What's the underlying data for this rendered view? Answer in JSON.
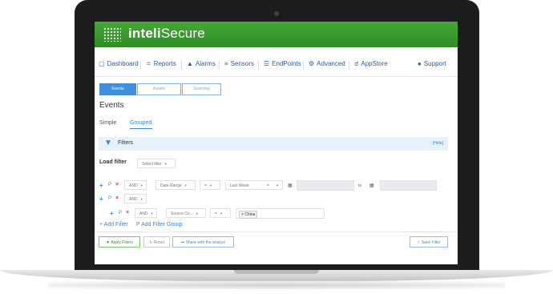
{
  "header": {
    "logo_prefix": "inteli",
    "logo_suffix": "Secure"
  },
  "nav": {
    "items": [
      {
        "label": "Dashboard",
        "icon": "monitor-icon"
      },
      {
        "label": "Reports",
        "icon": "chart-icon"
      },
      {
        "label": "Alarms",
        "icon": "bell-icon"
      },
      {
        "label": "Sensors",
        "icon": "sliders-icon"
      },
      {
        "label": "EndPoints",
        "icon": "list-icon"
      },
      {
        "label": "Advanced",
        "icon": "cogs-icon"
      },
      {
        "label": "AppStore",
        "icon": "cart-icon"
      }
    ],
    "support": {
      "label": "Support",
      "icon": "chat-icon"
    }
  },
  "tabs": [
    "Events",
    "Assets",
    "Scanning"
  ],
  "page_title": "Events",
  "subtabs": [
    "Simple",
    "Grouped"
  ],
  "filters": {
    "title": "Filters",
    "hide_label": "[Hide]"
  },
  "load_filter": {
    "label": "Load filter",
    "placeholder": "Select filter"
  },
  "rows": {
    "r1": {
      "op": "AND",
      "field": "Date Range",
      "cond": "=",
      "value": "Last Week",
      "value_op": "=",
      "to": "to"
    },
    "r2": {
      "op": "AND"
    },
    "r3": {
      "op": "AND",
      "field": "Source Co...",
      "cond": "=",
      "tag": "China",
      "tag_remove": "×"
    }
  },
  "row_controls": {
    "add": "+",
    "group": "P",
    "remove": "×"
  },
  "links": {
    "add_filter": "Add Filter",
    "add_group": "Add Filter Group"
  },
  "buttons": {
    "apply": "Apply Filters",
    "reset": "Reset",
    "share": "Share with the analyst",
    "save": "Save Filter"
  },
  "colors": {
    "brand_green": "#3a9c2c",
    "accent_blue": "#3a86d8",
    "danger_red": "#d63b3b"
  }
}
